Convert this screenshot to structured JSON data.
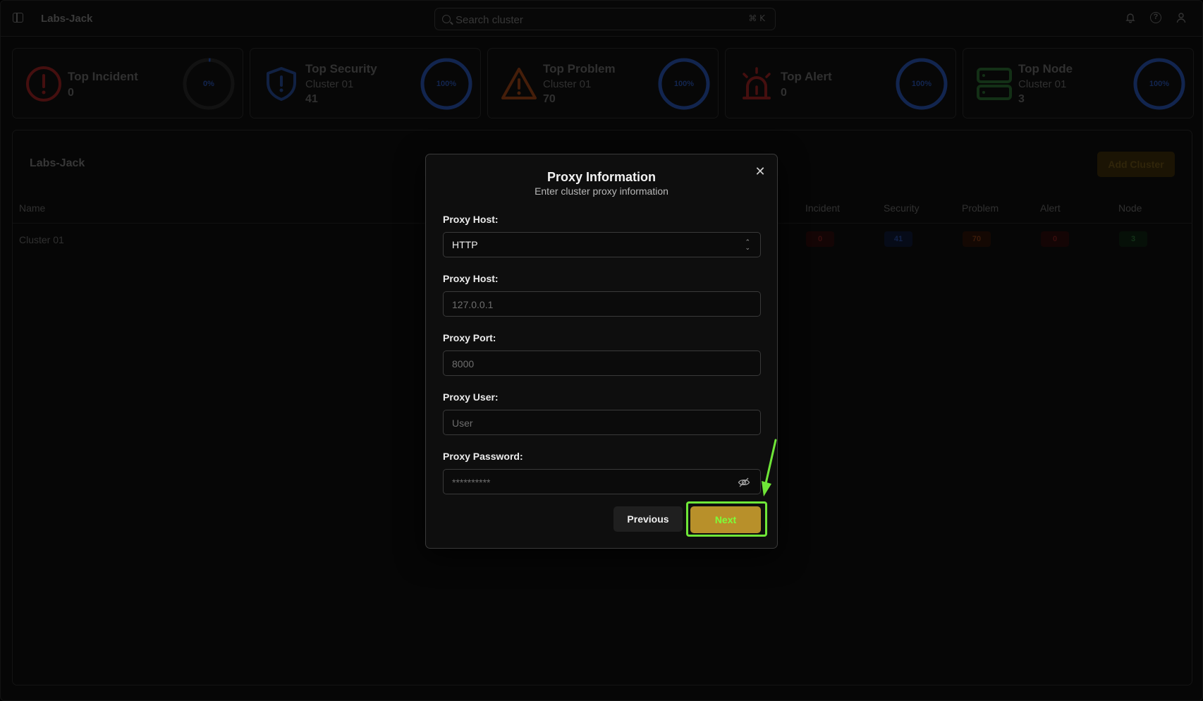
{
  "app": {
    "title": "Labs-Jack",
    "search_placeholder": "Search cluster",
    "search_shortcut": "⌘ K"
  },
  "cards": [
    {
      "title": "Top Incident",
      "subtitle": "",
      "value": "0",
      "ring_label": "0%",
      "ring_fraction": 0.0,
      "color": "#7a1a1a",
      "icon": "alert-circle-icon"
    },
    {
      "title": "Top Security",
      "subtitle": "Cluster 01",
      "value": "41",
      "ring_label": "100%",
      "ring_fraction": 1.0,
      "color": "#1b3a7a",
      "icon": "shield-icon"
    },
    {
      "title": "Top Problem",
      "subtitle": "Cluster 01",
      "value": "70",
      "ring_label": "100%",
      "ring_fraction": 1.0,
      "color": "#7a3510",
      "icon": "warning-triangle-icon"
    },
    {
      "title": "Top Alert",
      "subtitle": "",
      "value": "0",
      "ring_label": "100%",
      "ring_fraction": 1.0,
      "color": "#7a1a1a",
      "icon": "siren-icon"
    },
    {
      "title": "Top Node",
      "subtitle": "Cluster 01",
      "value": "3",
      "ring_label": "100%",
      "ring_fraction": 1.0,
      "color": "#1e5a2a",
      "icon": "server-icon"
    }
  ],
  "panel": {
    "title": "Labs-Jack",
    "add_button": "Add Cluster",
    "columns": [
      "Name",
      "Incident",
      "Security",
      "Problem",
      "Alert",
      "Node"
    ],
    "rows": [
      {
        "name": "Cluster 01",
        "incident": "0",
        "security": "41",
        "problem": "70",
        "alert": "0",
        "node": "3"
      }
    ]
  },
  "modal": {
    "title": "Proxy Information",
    "subtitle": "Enter cluster proxy information",
    "fields": {
      "protocol_label": "Proxy Host:",
      "protocol_value": "HTTP",
      "host_label": "Proxy Host:",
      "host_placeholder": "127.0.0.1",
      "port_label": "Proxy Port:",
      "port_placeholder": "8000",
      "user_label": "Proxy User:",
      "user_placeholder": "User",
      "password_label": "Proxy Password:",
      "password_placeholder": "**********"
    },
    "previous_button": "Previous",
    "next_button": "Next"
  },
  "colors": {
    "accent": "#b8902a",
    "highlight": "#6fe638"
  }
}
